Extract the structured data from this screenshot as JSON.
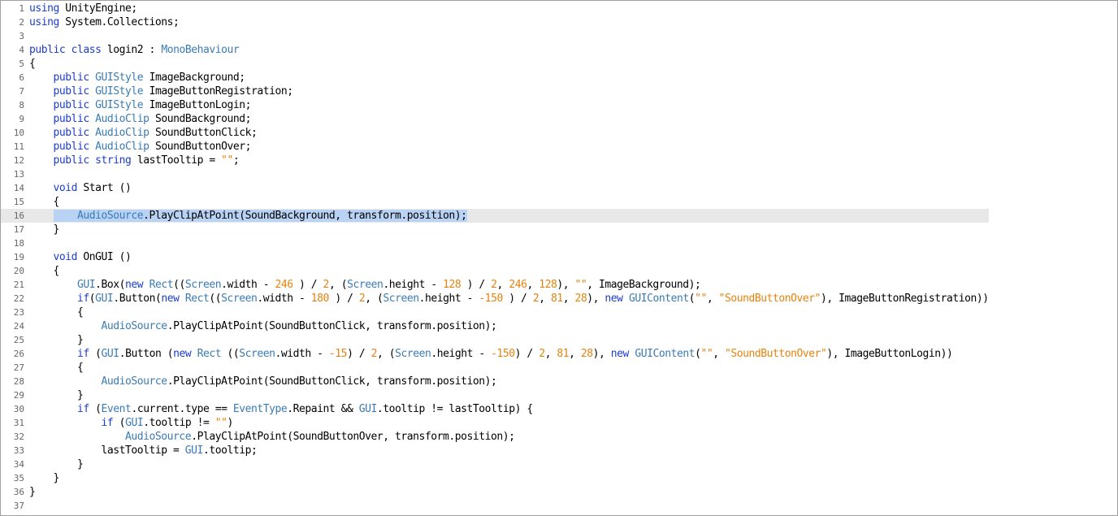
{
  "editor": {
    "current_line": 16,
    "lines": [
      {
        "n": "1",
        "tokens": [
          [
            "kw",
            "using"
          ],
          [
            "pl",
            " UnityEngine;"
          ]
        ]
      },
      {
        "n": "2",
        "tokens": [
          [
            "kw",
            "using"
          ],
          [
            "pl",
            " System.Collections;"
          ]
        ]
      },
      {
        "n": "3",
        "tokens": []
      },
      {
        "n": "4",
        "tokens": [
          [
            "kw",
            "public"
          ],
          [
            "pl",
            " "
          ],
          [
            "kw",
            "class"
          ],
          [
            "pl",
            " login2 : "
          ],
          [
            "ty",
            "MonoBehaviour"
          ]
        ]
      },
      {
        "n": "5",
        "tokens": [
          [
            "pl",
            "{"
          ]
        ]
      },
      {
        "n": "6",
        "tokens": [
          [
            "pl",
            "    "
          ],
          [
            "kw",
            "public"
          ],
          [
            "pl",
            " "
          ],
          [
            "ty",
            "GUIStyle"
          ],
          [
            "pl",
            " ImageBackground;"
          ]
        ]
      },
      {
        "n": "7",
        "tokens": [
          [
            "pl",
            "    "
          ],
          [
            "kw",
            "public"
          ],
          [
            "pl",
            " "
          ],
          [
            "ty",
            "GUIStyle"
          ],
          [
            "pl",
            " ImageButtonRegistration;"
          ]
        ]
      },
      {
        "n": "8",
        "tokens": [
          [
            "pl",
            "    "
          ],
          [
            "kw",
            "public"
          ],
          [
            "pl",
            " "
          ],
          [
            "ty",
            "GUIStyle"
          ],
          [
            "pl",
            " ImageButtonLogin;"
          ]
        ]
      },
      {
        "n": "9",
        "tokens": [
          [
            "pl",
            "    "
          ],
          [
            "kw",
            "public"
          ],
          [
            "pl",
            " "
          ],
          [
            "ty",
            "AudioClip"
          ],
          [
            "pl",
            " SoundBackground;"
          ]
        ]
      },
      {
        "n": "10",
        "tokens": [
          [
            "pl",
            "    "
          ],
          [
            "kw",
            "public"
          ],
          [
            "pl",
            " "
          ],
          [
            "ty",
            "AudioClip"
          ],
          [
            "pl",
            " SoundButtonClick;"
          ]
        ]
      },
      {
        "n": "11",
        "tokens": [
          [
            "pl",
            "    "
          ],
          [
            "kw",
            "public"
          ],
          [
            "pl",
            " "
          ],
          [
            "ty",
            "AudioClip"
          ],
          [
            "pl",
            " SoundButtonOver;"
          ]
        ]
      },
      {
        "n": "12",
        "tokens": [
          [
            "pl",
            "    "
          ],
          [
            "kw",
            "public"
          ],
          [
            "pl",
            " "
          ],
          [
            "kw",
            "string"
          ],
          [
            "pl",
            " lastTooltip = "
          ],
          [
            "str",
            "\"\""
          ],
          [
            "pl",
            ";"
          ]
        ]
      },
      {
        "n": "13",
        "tokens": []
      },
      {
        "n": "14",
        "tokens": [
          [
            "pl",
            "    "
          ],
          [
            "kw",
            "void"
          ],
          [
            "pl",
            " Start ()"
          ]
        ]
      },
      {
        "n": "15",
        "tokens": [
          [
            "pl",
            "    {"
          ]
        ]
      },
      {
        "n": "16",
        "tokens": [
          [
            "pl",
            "    "
          ],
          [
            "sel_ty",
            "    AudioSource"
          ],
          [
            "sel_pl",
            ".PlayClipAtPoint(SoundBackground, transform.position);"
          ]
        ]
      },
      {
        "n": "17",
        "tokens": [
          [
            "pl",
            "    }"
          ]
        ]
      },
      {
        "n": "18",
        "tokens": []
      },
      {
        "n": "19",
        "tokens": [
          [
            "pl",
            "    "
          ],
          [
            "kw",
            "void"
          ],
          [
            "pl",
            " OnGUI ()"
          ]
        ]
      },
      {
        "n": "20",
        "tokens": [
          [
            "pl",
            "    {"
          ]
        ]
      },
      {
        "n": "21",
        "tokens": [
          [
            "pl",
            "        "
          ],
          [
            "ty",
            "GUI"
          ],
          [
            "pl",
            ".Box("
          ],
          [
            "kw",
            "new"
          ],
          [
            "pl",
            " "
          ],
          [
            "ty",
            "Rect"
          ],
          [
            "pl",
            "(("
          ],
          [
            "ty",
            "Screen"
          ],
          [
            "pl",
            ".width - "
          ],
          [
            "num",
            "246"
          ],
          [
            "pl",
            " ) / "
          ],
          [
            "num",
            "2"
          ],
          [
            "pl",
            ", ("
          ],
          [
            "ty",
            "Screen"
          ],
          [
            "pl",
            ".height - "
          ],
          [
            "num",
            "128"
          ],
          [
            "pl",
            " ) / "
          ],
          [
            "num",
            "2"
          ],
          [
            "pl",
            ", "
          ],
          [
            "num",
            "246"
          ],
          [
            "pl",
            ", "
          ],
          [
            "num",
            "128"
          ],
          [
            "pl",
            "), "
          ],
          [
            "str",
            "\"\""
          ],
          [
            "pl",
            ", ImageBackground);"
          ]
        ]
      },
      {
        "n": "22",
        "tokens": [
          [
            "pl",
            "        "
          ],
          [
            "kw",
            "if"
          ],
          [
            "pl",
            "("
          ],
          [
            "ty",
            "GUI"
          ],
          [
            "pl",
            ".Button("
          ],
          [
            "kw",
            "new"
          ],
          [
            "pl",
            " "
          ],
          [
            "ty",
            "Rect"
          ],
          [
            "pl",
            "(("
          ],
          [
            "ty",
            "Screen"
          ],
          [
            "pl",
            ".width - "
          ],
          [
            "num",
            "180"
          ],
          [
            "pl",
            " ) / "
          ],
          [
            "num",
            "2"
          ],
          [
            "pl",
            ", ("
          ],
          [
            "ty",
            "Screen"
          ],
          [
            "pl",
            ".height - "
          ],
          [
            "num",
            "-150"
          ],
          [
            "pl",
            " ) / "
          ],
          [
            "num",
            "2"
          ],
          [
            "pl",
            ", "
          ],
          [
            "num",
            "81"
          ],
          [
            "pl",
            ", "
          ],
          [
            "num",
            "28"
          ],
          [
            "pl",
            "), "
          ],
          [
            "kw",
            "new"
          ],
          [
            "pl",
            " "
          ],
          [
            "ty",
            "GUIContent"
          ],
          [
            "pl",
            "("
          ],
          [
            "str",
            "\"\""
          ],
          [
            "pl",
            ", "
          ],
          [
            "str",
            "\"SoundButtonOver\""
          ],
          [
            "pl",
            "), ImageButtonRegistration))"
          ]
        ]
      },
      {
        "n": "23",
        "tokens": [
          [
            "pl",
            "        {"
          ]
        ]
      },
      {
        "n": "24",
        "tokens": [
          [
            "pl",
            "            "
          ],
          [
            "ty",
            "AudioSource"
          ],
          [
            "pl",
            ".PlayClipAtPoint(SoundButtonClick, transform.position);"
          ]
        ]
      },
      {
        "n": "25",
        "tokens": [
          [
            "pl",
            "        }"
          ]
        ]
      },
      {
        "n": "26",
        "tokens": [
          [
            "pl",
            "        "
          ],
          [
            "kw",
            "if"
          ],
          [
            "pl",
            " ("
          ],
          [
            "ty",
            "GUI"
          ],
          [
            "pl",
            ".Button ("
          ],
          [
            "kw",
            "new"
          ],
          [
            "pl",
            " "
          ],
          [
            "ty",
            "Rect"
          ],
          [
            "pl",
            " (("
          ],
          [
            "ty",
            "Screen"
          ],
          [
            "pl",
            ".width - "
          ],
          [
            "num",
            "-15"
          ],
          [
            "pl",
            ") / "
          ],
          [
            "num",
            "2"
          ],
          [
            "pl",
            ", ("
          ],
          [
            "ty",
            "Screen"
          ],
          [
            "pl",
            ".height - "
          ],
          [
            "num",
            "-150"
          ],
          [
            "pl",
            ") / "
          ],
          [
            "num",
            "2"
          ],
          [
            "pl",
            ", "
          ],
          [
            "num",
            "81"
          ],
          [
            "pl",
            ", "
          ],
          [
            "num",
            "28"
          ],
          [
            "pl",
            "), "
          ],
          [
            "kw",
            "new"
          ],
          [
            "pl",
            " "
          ],
          [
            "ty",
            "GUIContent"
          ],
          [
            "pl",
            "("
          ],
          [
            "str",
            "\"\""
          ],
          [
            "pl",
            ", "
          ],
          [
            "str",
            "\"SoundButtonOver\""
          ],
          [
            "pl",
            "), ImageButtonLogin))"
          ]
        ]
      },
      {
        "n": "27",
        "tokens": [
          [
            "pl",
            "        {"
          ]
        ]
      },
      {
        "n": "28",
        "tokens": [
          [
            "pl",
            "            "
          ],
          [
            "ty",
            "AudioSource"
          ],
          [
            "pl",
            ".PlayClipAtPoint(SoundButtonClick, transform.position);"
          ]
        ]
      },
      {
        "n": "29",
        "tokens": [
          [
            "pl",
            "        }"
          ]
        ]
      },
      {
        "n": "30",
        "tokens": [
          [
            "pl",
            "        "
          ],
          [
            "kw",
            "if"
          ],
          [
            "pl",
            " ("
          ],
          [
            "ty",
            "Event"
          ],
          [
            "pl",
            ".current.type == "
          ],
          [
            "ty",
            "EventType"
          ],
          [
            "pl",
            ".Repaint && "
          ],
          [
            "ty",
            "GUI"
          ],
          [
            "pl",
            ".tooltip != lastTooltip) {"
          ]
        ]
      },
      {
        "n": "31",
        "tokens": [
          [
            "pl",
            "            "
          ],
          [
            "kw",
            "if"
          ],
          [
            "pl",
            " ("
          ],
          [
            "ty",
            "GUI"
          ],
          [
            "pl",
            ".tooltip != "
          ],
          [
            "str",
            "\"\""
          ],
          [
            "pl",
            ")"
          ]
        ]
      },
      {
        "n": "32",
        "tokens": [
          [
            "pl",
            "                "
          ],
          [
            "ty",
            "AudioSource"
          ],
          [
            "pl",
            ".PlayClipAtPoint(SoundButtonOver, transform.position);"
          ]
        ]
      },
      {
        "n": "33",
        "tokens": [
          [
            "pl",
            "            lastTooltip = "
          ],
          [
            "ty",
            "GUI"
          ],
          [
            "pl",
            ".tooltip;"
          ]
        ]
      },
      {
        "n": "34",
        "tokens": [
          [
            "pl",
            "        }"
          ]
        ]
      },
      {
        "n": "35",
        "tokens": [
          [
            "pl",
            "    }"
          ]
        ]
      },
      {
        "n": "36",
        "tokens": [
          [
            "pl",
            "}"
          ]
        ]
      },
      {
        "n": "37",
        "tokens": []
      }
    ]
  }
}
